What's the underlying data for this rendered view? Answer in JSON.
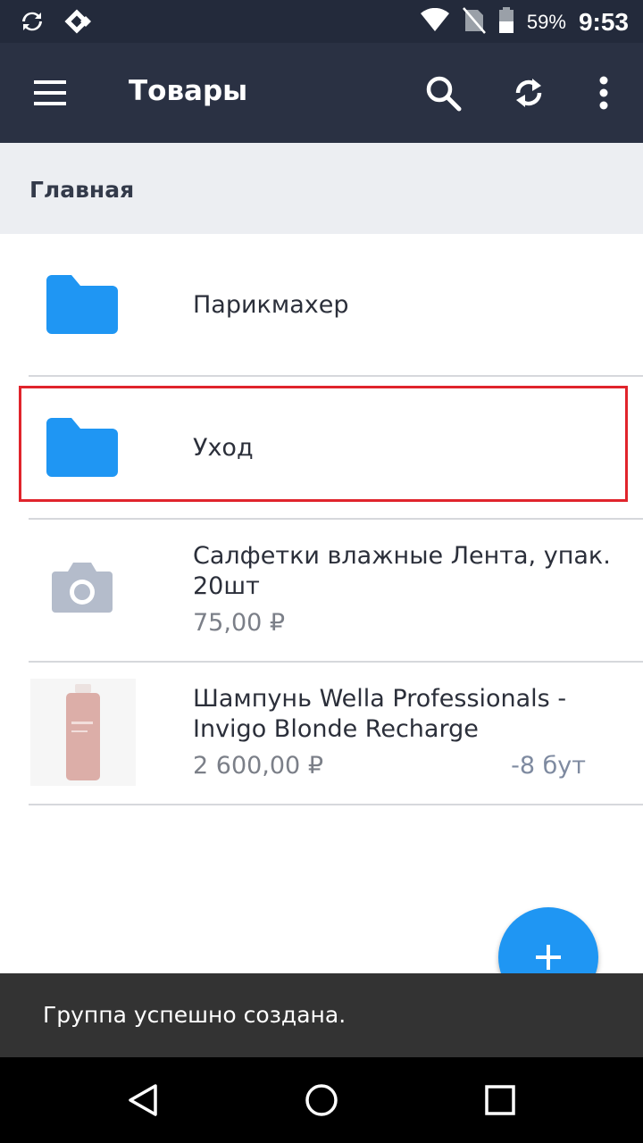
{
  "status_bar": {
    "battery": "59%",
    "time": "9:53",
    "icons": [
      "sync-icon",
      "dash-icon",
      "wifi-icon",
      "no-sim-icon",
      "battery-icon"
    ]
  },
  "toolbar": {
    "title": "Товары",
    "icons": [
      "menu-icon",
      "search-icon",
      "refresh-icon",
      "more-vert-icon"
    ]
  },
  "breadcrumb": {
    "label": "Главная"
  },
  "list": {
    "folders": [
      {
        "name": "Парикмахер",
        "icon": "folder-icon"
      },
      {
        "name": "Уход",
        "icon": "folder-icon"
      }
    ],
    "products": [
      {
        "name": "Салфетки влажные Лента, упак. 20шт",
        "price": "75,00 ₽",
        "stock": "",
        "icon": "camera-placeholder-icon"
      },
      {
        "name": "Шампунь Wella Professionals - Invigo Blonde Recharge",
        "price": "2 600,00 ₽",
        "stock": "-8 бут",
        "icon": "product-thumbnail"
      }
    ]
  },
  "fab": {
    "icon": "plus-icon"
  },
  "snackbar": {
    "message": "Группа успешно создана."
  },
  "navbar": {
    "icons": [
      "back-icon",
      "home-icon",
      "recents-icon"
    ]
  },
  "colors": {
    "toolbar": "#2a3143",
    "status_bar": "#232a3b",
    "accent": "#1f96f3",
    "highlight": "#e0242c",
    "breadcrumb_bg": "#eceef2"
  }
}
